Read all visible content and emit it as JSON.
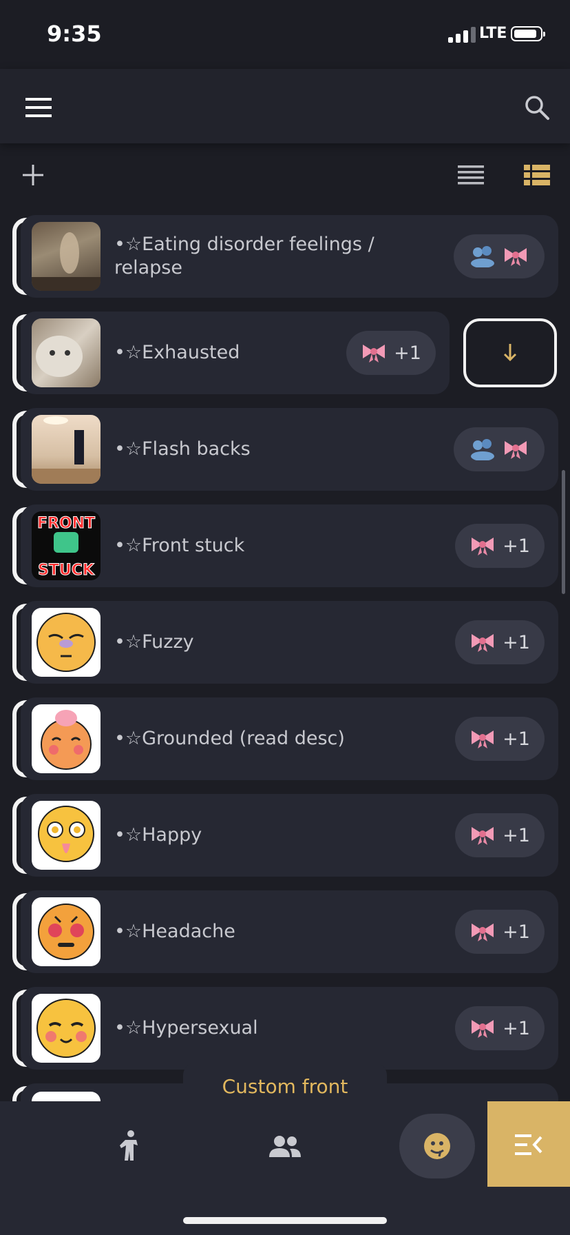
{
  "status": {
    "time": "9:35",
    "network": "LTE"
  },
  "header": {
    "menu_icon": "hamburger-menu-icon",
    "search_icon": "search-icon"
  },
  "toolbar": {
    "add_icon": "plus-icon",
    "list_view_icon": "list-view-icon",
    "detailed_view_icon": "detailed-list-icon"
  },
  "fronts": [
    {
      "name": "•☆Eating disorder feelings / relapse",
      "badge": "",
      "badge_icons": [
        "people-icon",
        "bow-icon"
      ]
    },
    {
      "name": "•☆Exhausted",
      "badge": "+1",
      "badge_icons": [
        "bow-icon"
      ]
    },
    {
      "name": "•☆Flash backs",
      "badge": "",
      "badge_icons": [
        "people-icon",
        "bow-icon"
      ]
    },
    {
      "name": "•☆Front stuck",
      "badge": "+1",
      "badge_icons": [
        "bow-icon"
      ]
    },
    {
      "name": "•☆Fuzzy",
      "badge": "+1",
      "badge_icons": [
        "bow-icon"
      ]
    },
    {
      "name": "•☆Grounded (read desc)",
      "badge": "+1",
      "badge_icons": [
        "bow-icon"
      ]
    },
    {
      "name": "•☆Happy",
      "badge": "+1",
      "badge_icons": [
        "bow-icon"
      ]
    },
    {
      "name": "•☆Headache",
      "badge": "+1",
      "badge_icons": [
        "bow-icon"
      ]
    },
    {
      "name": "•☆Hypersexual",
      "badge": "+1",
      "badge_icons": [
        "bow-icon"
      ]
    }
  ],
  "avatar_text": {
    "front_stuck_top": "FRONT",
    "front_stuck_bottom": "STUCK"
  },
  "custom_front_tab": "Custom front",
  "nav": {
    "items": [
      "fronter-icon",
      "members-icon",
      "custom-front-icon",
      "collapse-menu-icon"
    ]
  },
  "colors": {
    "accent": "#d9b466",
    "background": "#1c1d24",
    "card": "#262833",
    "pill": "#383a47"
  }
}
